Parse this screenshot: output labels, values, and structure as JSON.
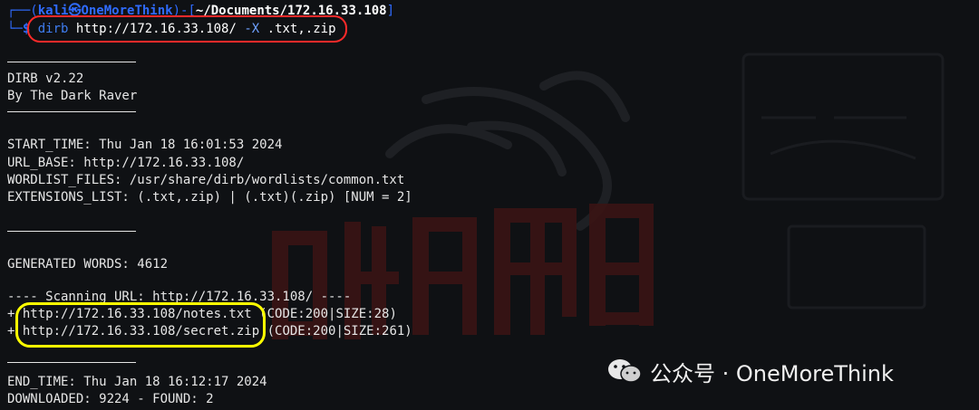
{
  "prompt": {
    "corner": "┌──(",
    "user": "kali",
    "at": "㉿",
    "host": "OneMoreThink",
    "sep": ")-[",
    "path": "~/Documents/172.16.33.108",
    "close": "]",
    "arrow": "└─",
    "dollar": "$"
  },
  "command": {
    "tool": "dirb",
    "url": "http://172.16.33.108/",
    "flag": "-X",
    "value": ".txt,.zip"
  },
  "banner": {
    "name": "DIRB v2.22",
    "author": "By The Dark Raver"
  },
  "info": {
    "start_time": "START_TIME: Thu Jan 18 16:01:53 2024",
    "url_base": "URL_BASE: http://172.16.33.108/",
    "wordlist": "WORDLIST_FILES: /usr/share/dirb/wordlists/common.txt",
    "extensions": "EXTENSIONS_LIST: (.txt,.zip) | (.txt)(.zip) [NUM = 2]"
  },
  "generated": "GENERATED WORDS: 4612",
  "scanning": "---- Scanning URL: http://172.16.33.108/ ----",
  "results": [
    {
      "prefix": "+ ",
      "url": "http://172.16.33.108/notes.txt",
      "meta": " (CODE:200|SIZE:28)"
    },
    {
      "prefix": "+ ",
      "url": "http://172.16.33.108/secret.zip",
      "meta": " (CODE:200|SIZE:261)"
    }
  ],
  "end_time": "END_TIME: Thu Jan 18 16:12:17 2024",
  "downloaded": "DOWNLOADED: 9224 - FOUND: 2",
  "watermark": {
    "label": "公众号 · OneMoreThink"
  }
}
